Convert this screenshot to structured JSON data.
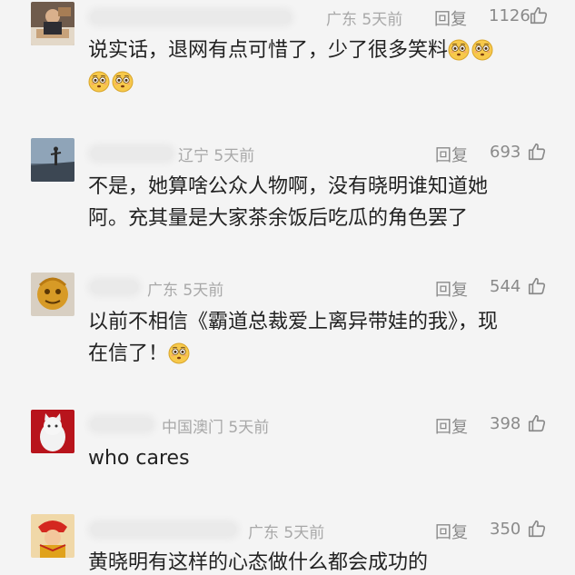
{
  "comments": [
    {
      "location": "广东",
      "time": "5天前",
      "reply_label": "回复",
      "likes": "1126",
      "text": "说实话，退网有点可惜了，少了很多笑料",
      "emoji_after_text": 2,
      "emoji_second_line": 2
    },
    {
      "location": "辽宁",
      "time": "5天前",
      "reply_label": "回复",
      "likes": "693",
      "text_line1": "不是，她算啥公众人物啊，没有晓明谁知道她",
      "text_line2": "阿。充其量是大家茶余饭后吃瓜的角色罢了"
    },
    {
      "location": "广东",
      "time": "5天前",
      "reply_label": "回复",
      "likes": "544",
      "text_line1": "以前不相信《霸道总裁爱上离异带娃的我》，现",
      "text_line2": "在信了！",
      "emoji_after_line2": 1
    },
    {
      "location": "中国澳门",
      "time": "5天前",
      "reply_label": "回复",
      "likes": "398",
      "text": "who cares"
    },
    {
      "location": "广东",
      "time": "5天前",
      "reply_label": "回复",
      "likes": "350",
      "text": "黄晓明有这样的心态做什么都会成功的"
    }
  ],
  "icons": {
    "like": "thumbs-up-icon",
    "emoji": "flushed-face-emoji"
  },
  "colors": {
    "background": "#f4f4f4",
    "meta_text": "#a8a8a8",
    "body_text": "#222222"
  }
}
